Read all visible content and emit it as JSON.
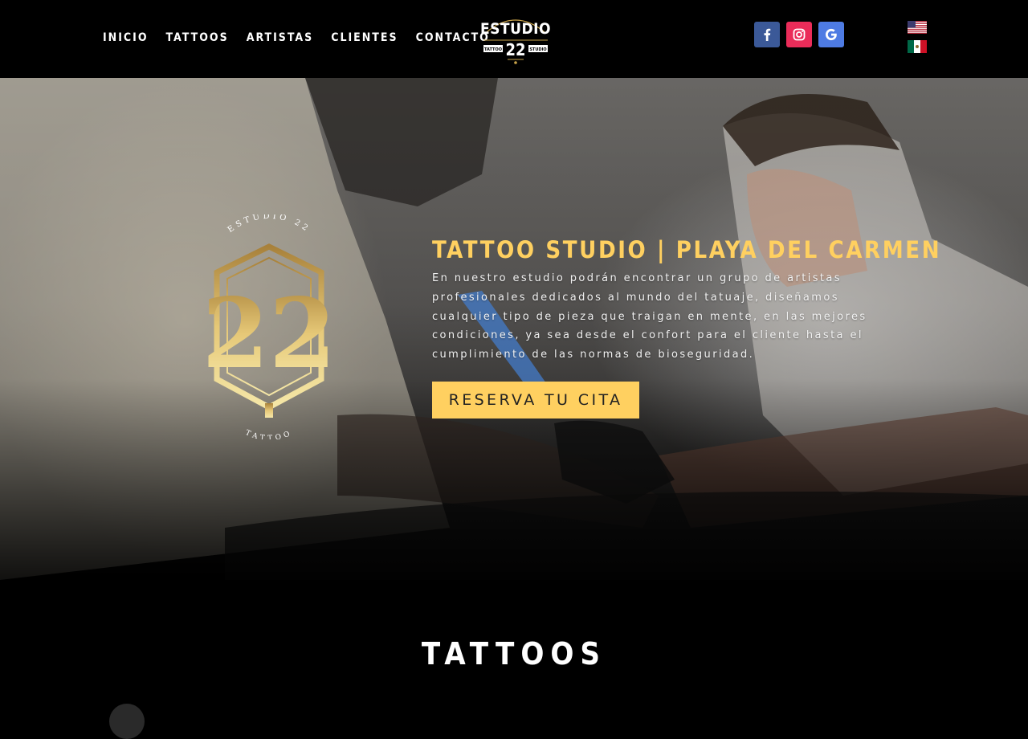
{
  "nav": {
    "items": [
      {
        "label": "INICIO"
      },
      {
        "label": "TATTOOS"
      },
      {
        "label": "ARTISTAS"
      },
      {
        "label": "CLIENTES"
      },
      {
        "label": "CONTACTO"
      }
    ]
  },
  "logo": {
    "wordmark": "ESTUDIO",
    "number": "22",
    "left_tag": "TATTOO",
    "right_tag": "STUDIO"
  },
  "social": [
    {
      "icon": "facebook-icon",
      "color": "#3b5998"
    },
    {
      "icon": "instagram-icon",
      "color": "#ea2c59"
    },
    {
      "icon": "google-icon",
      "color": "#4e7be3"
    }
  ],
  "languages": [
    {
      "icon": "us-flag-icon"
    },
    {
      "icon": "mexico-flag-icon"
    }
  ],
  "hero": {
    "title": "TATTOO STUDIO | PLAYA DEL CARMEN",
    "description": "En nuestro estudio podrán encontrar un grupo de artistas profesionales dedicados al mundo del tatuaje, diseñamos cualquier tipo de pieza que traigan en mente, en las mejores condiciones, ya sea desde el confort para el cliente hasta el cumplimiento de las normas de bioseguridad.",
    "cta_label": "RESERVA TU CITA",
    "emblem": {
      "top_text": "ESTUDIO 22",
      "bottom_text": "TATTOO",
      "number": "22"
    }
  },
  "section": {
    "title": "TATTOOS"
  },
  "colors": {
    "accent": "#ffd060",
    "background": "#000000",
    "gold": "#c9a34a"
  }
}
